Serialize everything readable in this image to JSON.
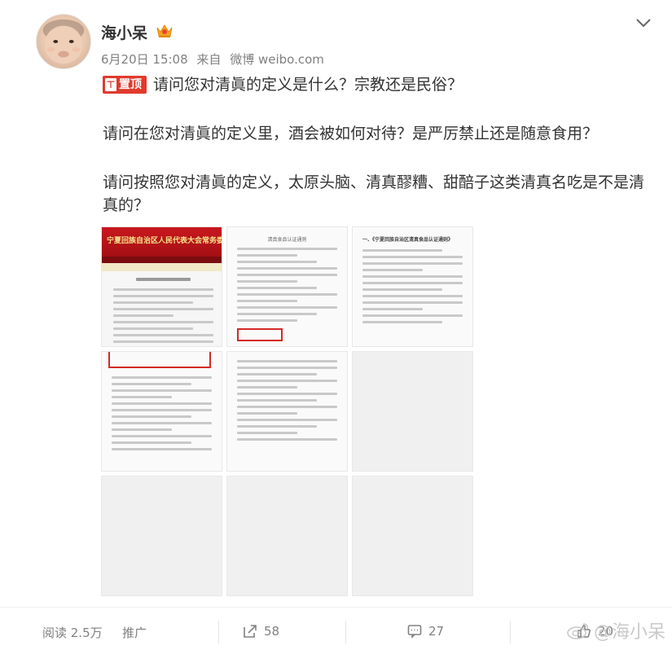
{
  "user": {
    "name": "海小呆",
    "date": "6月20日 15:08",
    "source_prefix": "来自",
    "source": "微博 weibo.com"
  },
  "post": {
    "pin_label": "置顶",
    "line1": "请问您对清眞的定义是什么？宗教还是民俗？",
    "line2": "请问在您对清眞的定义里，酒会被如何对待？是严厉禁止还是随意食用？",
    "line3": "请问按照您对清眞的定义，太原头脑、清真醪糟、甜醅子这类清真名吃是不是清真的？"
  },
  "images": {
    "web_banner": "宁夏回族自治区人民代表大会常务委员会",
    "doc1_title": "清真食品认证通则",
    "doc2_title": "一、《宁夏回族自治区清真食品认证通则》"
  },
  "footer": {
    "reads_label": "阅读 2.5万",
    "promote_label": "推广",
    "repost_count": "58",
    "comment_count": "27",
    "like_count": "20",
    "watermark": "@海小呆"
  },
  "colors": {
    "pin_red": "#e03a2d",
    "text": "#333333",
    "meta": "#808080"
  }
}
